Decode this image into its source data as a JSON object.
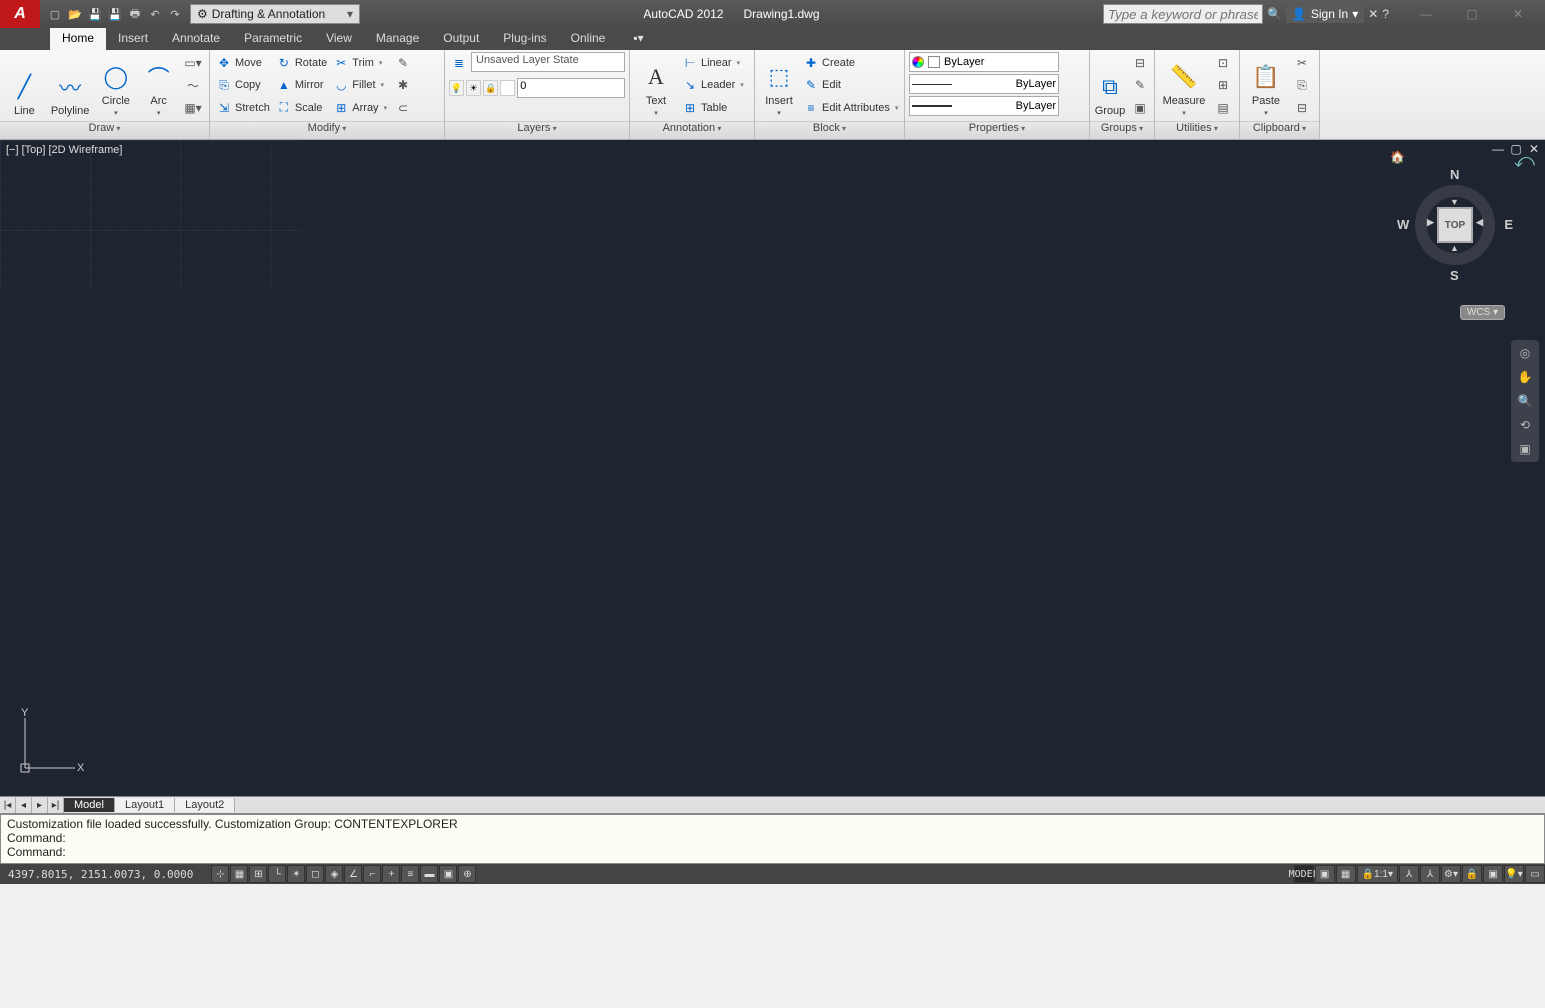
{
  "title": {
    "app": "AutoCAD 2012",
    "file": "Drawing1.dwg"
  },
  "workspace": "Drafting & Annotation",
  "search_placeholder": "Type a keyword or phrase",
  "signin": "Sign In",
  "tabs": [
    "Home",
    "Insert",
    "Annotate",
    "Parametric",
    "View",
    "Manage",
    "Output",
    "Plug-ins",
    "Online"
  ],
  "ribbon": {
    "draw": {
      "label": "Draw",
      "line": "Line",
      "polyline": "Polyline",
      "circle": "Circle",
      "arc": "Arc"
    },
    "modify": {
      "label": "Modify",
      "move": "Move",
      "rotate": "Rotate",
      "trim": "Trim",
      "copy": "Copy",
      "mirror": "Mirror",
      "fillet": "Fillet",
      "stretch": "Stretch",
      "scale": "Scale",
      "array": "Array"
    },
    "layers": {
      "label": "Layers",
      "state": "Unsaved Layer State",
      "current": "0"
    },
    "annotation": {
      "label": "Annotation",
      "text": "Text",
      "linear": "Linear",
      "leader": "Leader",
      "table": "Table"
    },
    "block": {
      "label": "Block",
      "insert": "Insert",
      "create": "Create",
      "edit": "Edit",
      "attrs": "Edit Attributes"
    },
    "properties": {
      "label": "Properties",
      "color": "ByLayer",
      "ltype": "ByLayer",
      "lweight": "ByLayer"
    },
    "groups": {
      "label": "Groups",
      "group": "Group"
    },
    "utilities": {
      "label": "Utilities",
      "measure": "Measure"
    },
    "clipboard": {
      "label": "Clipboard",
      "paste": "Paste"
    }
  },
  "viewport_label": "[−] [Top] [2D Wireframe]",
  "viewcube": {
    "face": "TOP",
    "n": "N",
    "s": "S",
    "e": "E",
    "w": "W",
    "wcs": "WCS"
  },
  "layout_tabs": [
    "Model",
    "Layout1",
    "Layout2"
  ],
  "command": {
    "line1": "Customization file loaded successfully. Customization Group: CONTENTEXPLORER",
    "line2": "Command:",
    "line3": "Command:"
  },
  "status": {
    "coords": "4397.8015, 2151.0073, 0.0000",
    "model": "MODEL",
    "scale": "1:1"
  }
}
